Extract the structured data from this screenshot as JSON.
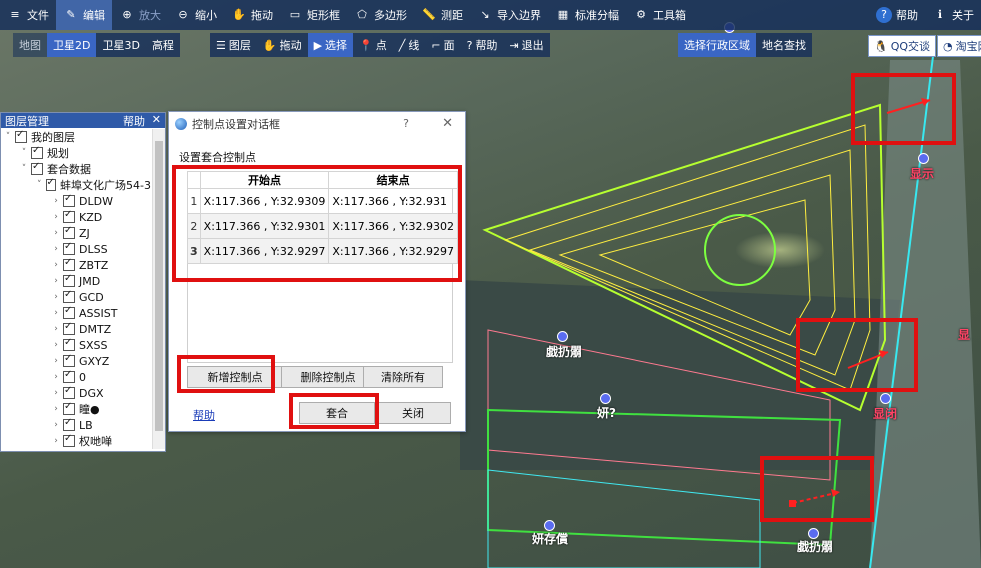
{
  "toolbar1": {
    "items": [
      "文件",
      "编辑",
      "放大",
      "缩小",
      "拖动",
      "矩形框",
      "多边形",
      "测距",
      "导入边界",
      "标准分幅",
      "工具箱"
    ],
    "help": "帮助",
    "close": "关于"
  },
  "toolbar2": {
    "maptypes": [
      "地图",
      "卫星2D",
      "卫星3D",
      "高程"
    ],
    "tools": [
      "图层",
      "拖动",
      "选择",
      "点",
      "线",
      "面",
      "帮助",
      "退出"
    ]
  },
  "region": {
    "select_label": "选择行政区域",
    "search_label": "地名查找"
  },
  "top_right": {
    "qq": "QQ交谈",
    "taobao": "淘宝网"
  },
  "layer_panel": {
    "title": "图层管理",
    "help": "帮助",
    "close": "✕",
    "nodes": [
      {
        "label": "我的图层",
        "level": 0
      },
      {
        "label": "规划",
        "level": 1
      },
      {
        "label": "套合数据",
        "level": 1
      },
      {
        "label": "蚌埠文化广场54-3",
        "level": 2
      },
      {
        "label": "DLDW",
        "level": 3
      },
      {
        "label": "KZD",
        "level": 3
      },
      {
        "label": "ZJ",
        "level": 3
      },
      {
        "label": "DLSS",
        "level": 3
      },
      {
        "label": "ZBTZ",
        "level": 3
      },
      {
        "label": "JMD",
        "level": 3
      },
      {
        "label": "GCD",
        "level": 3
      },
      {
        "label": "ASSIST",
        "level": 3
      },
      {
        "label": "DMTZ",
        "level": 3
      },
      {
        "label": "SXSS",
        "level": 3
      },
      {
        "label": "GXYZ",
        "level": 3
      },
      {
        "label": "0",
        "level": 3
      },
      {
        "label": "DGX",
        "level": 3
      },
      {
        "label": "瞳●",
        "level": 3
      },
      {
        "label": "LB",
        "level": 3
      },
      {
        "label": "权哋啴",
        "level": 3
      }
    ]
  },
  "dialog": {
    "title": "控制点设置对话框",
    "help": "?",
    "close": "✕",
    "subtitle": "设置套合控制点",
    "columns": [
      "开始点",
      "结束点"
    ],
    "rows": [
      {
        "n": "1",
        "start": "X:117.366 , Y:32.9309",
        "end": "X:117.366 , Y:32.931"
      },
      {
        "n": "2",
        "start": "X:117.366 , Y:32.9301",
        "end": "X:117.366 , Y:32.9302"
      },
      {
        "n": "3",
        "start": "X:117.366 , Y:32.9297",
        "end": "X:117.366 , Y:32.9297"
      }
    ],
    "add_btn": "新增控制点",
    "del_btn": "删除控制点",
    "clear_btn": "清除所有",
    "help_link": "帮助",
    "fit_btn": "套合",
    "close_btn": "关闭"
  },
  "map_labels": [
    "显示",
    "戯扔朤",
    "妍?",
    "显闭",
    "显",
    "戯扔朤",
    "妍存償"
  ],
  "colors": {
    "highlight": "#e01010",
    "toolbar": "#14305a",
    "accent": "#3a66c4"
  }
}
